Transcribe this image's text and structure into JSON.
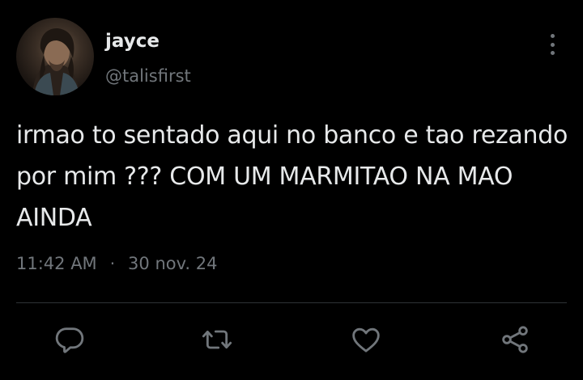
{
  "user": {
    "display_name": "jayce",
    "handle": "@talisfirst",
    "avatar_icon": "profile-avatar"
  },
  "tweet": {
    "lines": [
      "irmao to sentado aqui no banco e tao rezando",
      "por mim ??? COM UM MARMITAO NA MAO",
      "AINDA"
    ],
    "time": "11:42 AM",
    "separator": "·",
    "date": "30 nov. 24"
  },
  "actions": {
    "reply_icon": "reply-icon",
    "retweet_icon": "retweet-icon",
    "like_icon": "heart-icon",
    "share_icon": "share-icon"
  },
  "colors": {
    "background": "#000000",
    "text": "#e7e9ea",
    "secondary": "#71767b",
    "divider": "#2f3336"
  }
}
